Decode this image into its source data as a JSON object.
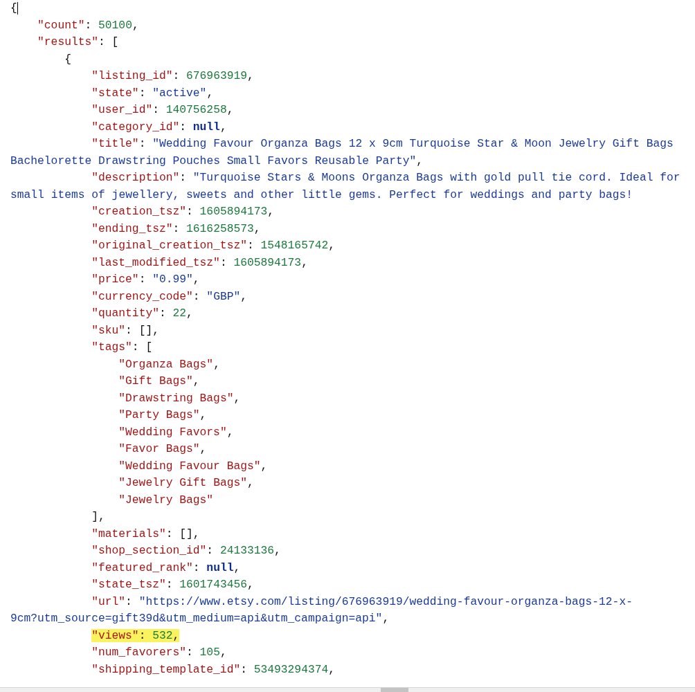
{
  "document": {
    "cursor": true,
    "open": [
      {
        "kind": "punct",
        "text": "{"
      }
    ],
    "children": [
      {
        "highlighted": false,
        "tokens": [
          {
            "kind": "key",
            "text": "\"count\""
          },
          {
            "kind": "punct",
            "text": ": "
          },
          {
            "kind": "number",
            "text": "50100"
          },
          {
            "kind": "punct",
            "text": ","
          }
        ]
      },
      {
        "highlighted": false,
        "tokens": [
          {
            "kind": "key",
            "text": "\"results\""
          },
          {
            "kind": "punct",
            "text": ": ["
          }
        ],
        "children": [
          {
            "highlighted": false,
            "tokens": [
              {
                "kind": "punct",
                "text": "{"
              }
            ],
            "children": [
              {
                "highlighted": false,
                "tokens": [
                  {
                    "kind": "key",
                    "text": "\"listing_id\""
                  },
                  {
                    "kind": "punct",
                    "text": ": "
                  },
                  {
                    "kind": "number",
                    "text": "676963919"
                  },
                  {
                    "kind": "punct",
                    "text": ","
                  }
                ]
              },
              {
                "highlighted": false,
                "tokens": [
                  {
                    "kind": "key",
                    "text": "\"state\""
                  },
                  {
                    "kind": "punct",
                    "text": ": "
                  },
                  {
                    "kind": "string",
                    "text": "\"active\""
                  },
                  {
                    "kind": "punct",
                    "text": ","
                  }
                ]
              },
              {
                "highlighted": false,
                "tokens": [
                  {
                    "kind": "key",
                    "text": "\"user_id\""
                  },
                  {
                    "kind": "punct",
                    "text": ": "
                  },
                  {
                    "kind": "number",
                    "text": "140756258"
                  },
                  {
                    "kind": "punct",
                    "text": ","
                  }
                ]
              },
              {
                "highlighted": false,
                "tokens": [
                  {
                    "kind": "key",
                    "text": "\"category_id\""
                  },
                  {
                    "kind": "punct",
                    "text": ": "
                  },
                  {
                    "kind": "null",
                    "text": "null"
                  },
                  {
                    "kind": "punct",
                    "text": ","
                  }
                ]
              },
              {
                "highlighted": false,
                "tokens": [
                  {
                    "kind": "key",
                    "text": "\"title\""
                  },
                  {
                    "kind": "punct",
                    "text": ": "
                  },
                  {
                    "kind": "string",
                    "text": "\"Wedding Favour Organza Bags 12 x 9cm Turquoise Star & Moon Jewelry Gift Bags Bachelorette Drawstring Pouches Small Favors Reusable Party\""
                  },
                  {
                    "kind": "punct",
                    "text": ","
                  }
                ]
              },
              {
                "highlighted": false,
                "tokens": [
                  {
                    "kind": "key",
                    "text": "\"description\""
                  },
                  {
                    "kind": "punct",
                    "text": ": "
                  },
                  {
                    "kind": "string",
                    "text": "\"Turquoise Stars & Moons Organza Bags with gold pull tie cord. Ideal for small items of jewellery, sweets and other little gems. Perfect for weddings and party bags!"
                  }
                ]
              },
              {
                "highlighted": false,
                "tokens": [
                  {
                    "kind": "key",
                    "text": "\"creation_tsz\""
                  },
                  {
                    "kind": "punct",
                    "text": ": "
                  },
                  {
                    "kind": "number",
                    "text": "1605894173"
                  },
                  {
                    "kind": "punct",
                    "text": ","
                  }
                ]
              },
              {
                "highlighted": false,
                "tokens": [
                  {
                    "kind": "key",
                    "text": "\"ending_tsz\""
                  },
                  {
                    "kind": "punct",
                    "text": ": "
                  },
                  {
                    "kind": "number",
                    "text": "1616258573"
                  },
                  {
                    "kind": "punct",
                    "text": ","
                  }
                ]
              },
              {
                "highlighted": false,
                "tokens": [
                  {
                    "kind": "key",
                    "text": "\"original_creation_tsz\""
                  },
                  {
                    "kind": "punct",
                    "text": ": "
                  },
                  {
                    "kind": "number",
                    "text": "1548165742"
                  },
                  {
                    "kind": "punct",
                    "text": ","
                  }
                ]
              },
              {
                "highlighted": false,
                "tokens": [
                  {
                    "kind": "key",
                    "text": "\"last_modified_tsz\""
                  },
                  {
                    "kind": "punct",
                    "text": ": "
                  },
                  {
                    "kind": "number",
                    "text": "1605894173"
                  },
                  {
                    "kind": "punct",
                    "text": ","
                  }
                ]
              },
              {
                "highlighted": false,
                "tokens": [
                  {
                    "kind": "key",
                    "text": "\"price\""
                  },
                  {
                    "kind": "punct",
                    "text": ": "
                  },
                  {
                    "kind": "string",
                    "text": "\"0.99\""
                  },
                  {
                    "kind": "punct",
                    "text": ","
                  }
                ]
              },
              {
                "highlighted": false,
                "tokens": [
                  {
                    "kind": "key",
                    "text": "\"currency_code\""
                  },
                  {
                    "kind": "punct",
                    "text": ": "
                  },
                  {
                    "kind": "string",
                    "text": "\"GBP\""
                  },
                  {
                    "kind": "punct",
                    "text": ","
                  }
                ]
              },
              {
                "highlighted": false,
                "tokens": [
                  {
                    "kind": "key",
                    "text": "\"quantity\""
                  },
                  {
                    "kind": "punct",
                    "text": ": "
                  },
                  {
                    "kind": "number",
                    "text": "22"
                  },
                  {
                    "kind": "punct",
                    "text": ","
                  }
                ]
              },
              {
                "highlighted": false,
                "tokens": [
                  {
                    "kind": "key",
                    "text": "\"sku\""
                  },
                  {
                    "kind": "punct",
                    "text": ": [],"
                  }
                ]
              },
              {
                "highlighted": false,
                "tokens": [
                  {
                    "kind": "key",
                    "text": "\"tags\""
                  },
                  {
                    "kind": "punct",
                    "text": ": ["
                  }
                ],
                "children": [
                  {
                    "highlighted": false,
                    "tokens": [
                      {
                        "kind": "key",
                        "text": "\"Organza Bags\""
                      },
                      {
                        "kind": "punct",
                        "text": ","
                      }
                    ]
                  },
                  {
                    "highlighted": false,
                    "tokens": [
                      {
                        "kind": "key",
                        "text": "\"Gift Bags\""
                      },
                      {
                        "kind": "punct",
                        "text": ","
                      }
                    ]
                  },
                  {
                    "highlighted": false,
                    "tokens": [
                      {
                        "kind": "key",
                        "text": "\"Drawstring Bags\""
                      },
                      {
                        "kind": "punct",
                        "text": ","
                      }
                    ]
                  },
                  {
                    "highlighted": false,
                    "tokens": [
                      {
                        "kind": "key",
                        "text": "\"Party Bags\""
                      },
                      {
                        "kind": "punct",
                        "text": ","
                      }
                    ]
                  },
                  {
                    "highlighted": false,
                    "tokens": [
                      {
                        "kind": "key",
                        "text": "\"Wedding Favors\""
                      },
                      {
                        "kind": "punct",
                        "text": ","
                      }
                    ]
                  },
                  {
                    "highlighted": false,
                    "tokens": [
                      {
                        "kind": "key",
                        "text": "\"Favor Bags\""
                      },
                      {
                        "kind": "punct",
                        "text": ","
                      }
                    ]
                  },
                  {
                    "highlighted": false,
                    "tokens": [
                      {
                        "kind": "key",
                        "text": "\"Wedding Favour Bags\""
                      },
                      {
                        "kind": "punct",
                        "text": ","
                      }
                    ]
                  },
                  {
                    "highlighted": false,
                    "tokens": [
                      {
                        "kind": "key",
                        "text": "\"Jewelry Gift Bags\""
                      },
                      {
                        "kind": "punct",
                        "text": ","
                      }
                    ]
                  },
                  {
                    "highlighted": false,
                    "tokens": [
                      {
                        "kind": "key",
                        "text": "\"Jewelry Bags\""
                      }
                    ]
                  }
                ],
                "close": [
                  {
                    "kind": "punct",
                    "text": "],"
                  }
                ]
              },
              {
                "highlighted": false,
                "tokens": [
                  {
                    "kind": "key",
                    "text": "\"materials\""
                  },
                  {
                    "kind": "punct",
                    "text": ": [],"
                  }
                ]
              },
              {
                "highlighted": false,
                "tokens": [
                  {
                    "kind": "key",
                    "text": "\"shop_section_id\""
                  },
                  {
                    "kind": "punct",
                    "text": ": "
                  },
                  {
                    "kind": "number",
                    "text": "24133136"
                  },
                  {
                    "kind": "punct",
                    "text": ","
                  }
                ]
              },
              {
                "highlighted": false,
                "tokens": [
                  {
                    "kind": "key",
                    "text": "\"featured_rank\""
                  },
                  {
                    "kind": "punct",
                    "text": ": "
                  },
                  {
                    "kind": "null",
                    "text": "null"
                  },
                  {
                    "kind": "punct",
                    "text": ","
                  }
                ]
              },
              {
                "highlighted": false,
                "tokens": [
                  {
                    "kind": "key",
                    "text": "\"state_tsz\""
                  },
                  {
                    "kind": "punct",
                    "text": ": "
                  },
                  {
                    "kind": "number",
                    "text": "1601743456"
                  },
                  {
                    "kind": "punct",
                    "text": ","
                  }
                ]
              },
              {
                "highlighted": false,
                "tokens": [
                  {
                    "kind": "key",
                    "text": "\"url\""
                  },
                  {
                    "kind": "punct",
                    "text": ": "
                  },
                  {
                    "kind": "string",
                    "text": "\"https://www.etsy.com/listing/676963919/wedding-favour-organza-bags-12-x-9cm?utm_source=gift39d&utm_medium=api&utm_campaign=api\""
                  },
                  {
                    "kind": "punct",
                    "text": ","
                  }
                ]
              },
              {
                "highlighted": true,
                "tokens": [
                  {
                    "kind": "key",
                    "text": "\"views\""
                  },
                  {
                    "kind": "punct",
                    "text": ": "
                  },
                  {
                    "kind": "number",
                    "text": "532"
                  },
                  {
                    "kind": "punct",
                    "text": ","
                  }
                ]
              },
              {
                "highlighted": false,
                "tokens": [
                  {
                    "kind": "key",
                    "text": "\"num_favorers\""
                  },
                  {
                    "kind": "punct",
                    "text": ": "
                  },
                  {
                    "kind": "number",
                    "text": "105"
                  },
                  {
                    "kind": "punct",
                    "text": ","
                  }
                ]
              },
              {
                "highlighted": false,
                "tokens": [
                  {
                    "kind": "key",
                    "text": "\"shipping_template_id\""
                  },
                  {
                    "kind": "punct",
                    "text": ": "
                  },
                  {
                    "kind": "number",
                    "text": "53493294374"
                  },
                  {
                    "kind": "punct",
                    "text": ","
                  }
                ]
              }
            ]
          }
        ]
      }
    ]
  }
}
